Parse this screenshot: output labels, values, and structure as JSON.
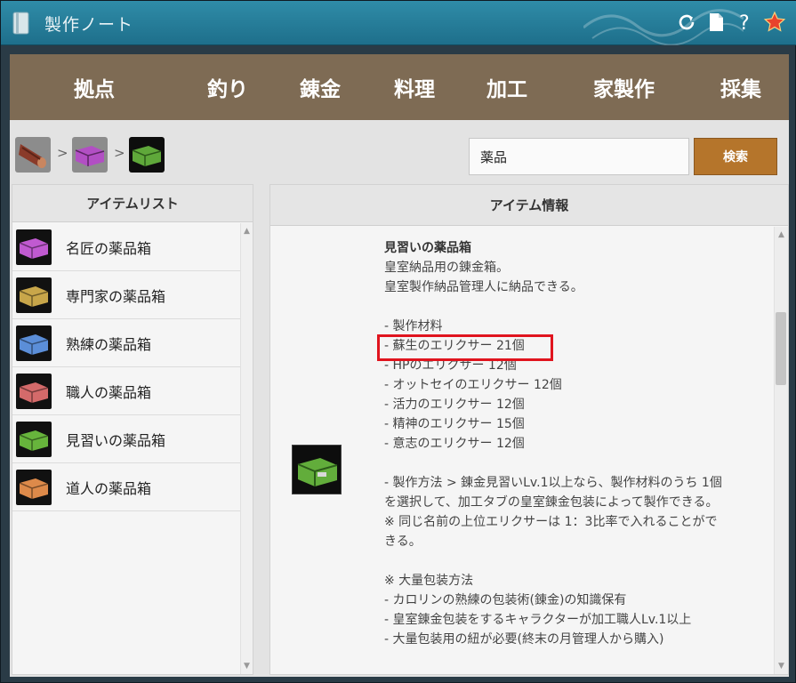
{
  "window": {
    "title": "製作ノート"
  },
  "titlebar_icons": [
    "refresh-icon",
    "page-icon",
    "help-icon",
    "star-icon"
  ],
  "nav": {
    "tabs": [
      {
        "label": "拠点"
      },
      {
        "label": "釣り"
      },
      {
        "label": "錬金"
      },
      {
        "label": "料理"
      },
      {
        "label": "加工"
      },
      {
        "label": "家製作"
      },
      {
        "label": "採集"
      }
    ]
  },
  "breadcrumb": {
    "separator": ">"
  },
  "search": {
    "value": "薬品",
    "button_label": "検索"
  },
  "item_list": {
    "header": "アイテムリスト",
    "items": [
      {
        "label": "名匠の薬品箱",
        "color": "#c05ad0"
      },
      {
        "label": "専門家の薬品箱",
        "color": "#c8a64a"
      },
      {
        "label": "熟練の薬品箱",
        "color": "#5b8ed8"
      },
      {
        "label": "職人の薬品箱",
        "color": "#d46a6a"
      },
      {
        "label": "見習いの薬品箱",
        "color": "#67b53c"
      },
      {
        "label": "道人の薬品箱",
        "color": "#dd8a4a"
      }
    ]
  },
  "item_info": {
    "header": "アイテム情報",
    "name": "見習いの薬品箱",
    "lines": [
      "皇室納品用の錬金箱。",
      "皇室製作納品管理人に納品できる。",
      "",
      "- 製作材料",
      "- 蘇生のエリクサー 21個",
      "- HPのエリクサー 12個",
      "- オットセイのエリクサー 12個",
      "- 活力のエリクサー 12個",
      "- 精神のエリクサー 15個",
      "- 意志のエリクサー 12個",
      "",
      "- 製作方法 > 錬金見習いLv.1以上なら、製作材料のうち 1個",
      "を選択して、加工タブの皇室錬金包装によって製作できる。",
      "※ 同じ名前の上位エリクサーは 1：3比率で入れることがで",
      "きる。",
      "",
      "※ 大量包装方法",
      "- カロリンの熟練の包装術(錬金)の知識保有",
      "- 皇室錬金包装をするキャラクターが加工職人Lv.1以上",
      "- 大量包装用の紐が必要(終末の月管理人から購入)"
    ]
  },
  "colors": {
    "nav_bg": "#7e6b54",
    "search_button": "#b5752b",
    "highlight": "#e0141e",
    "titlebar": "#2f8ca8"
  }
}
